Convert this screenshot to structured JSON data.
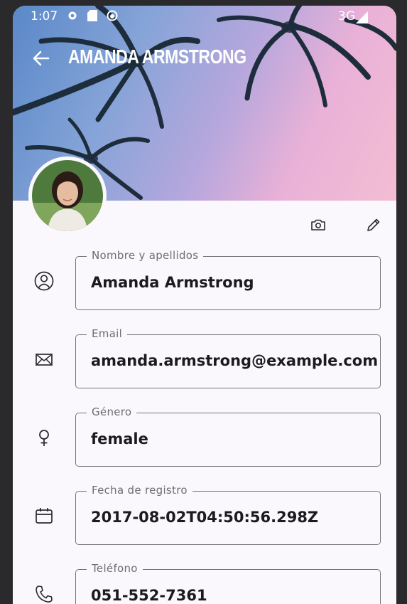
{
  "status_bar": {
    "time": "1:07",
    "network": "3G"
  },
  "header": {
    "title": "AMANDA ARMSTRONG"
  },
  "fields": [
    {
      "label": "Nombre y apellidos",
      "value": "Amanda Armstrong",
      "icon": "person-icon"
    },
    {
      "label": "Email",
      "value": "amanda.armstrong@example.com",
      "icon": "mail-icon"
    },
    {
      "label": "Género",
      "value": "female",
      "icon": "female-icon"
    },
    {
      "label": "Fecha de registro",
      "value": "2017-08-02T04:50:56.298Z",
      "icon": "calendar-icon"
    },
    {
      "label": "Teléfono",
      "value": "051-552-7361",
      "icon": "phone-icon"
    }
  ],
  "colors": {
    "background": "#fbf8fd",
    "outline": "#76747a",
    "text": "#1b1b1f"
  }
}
